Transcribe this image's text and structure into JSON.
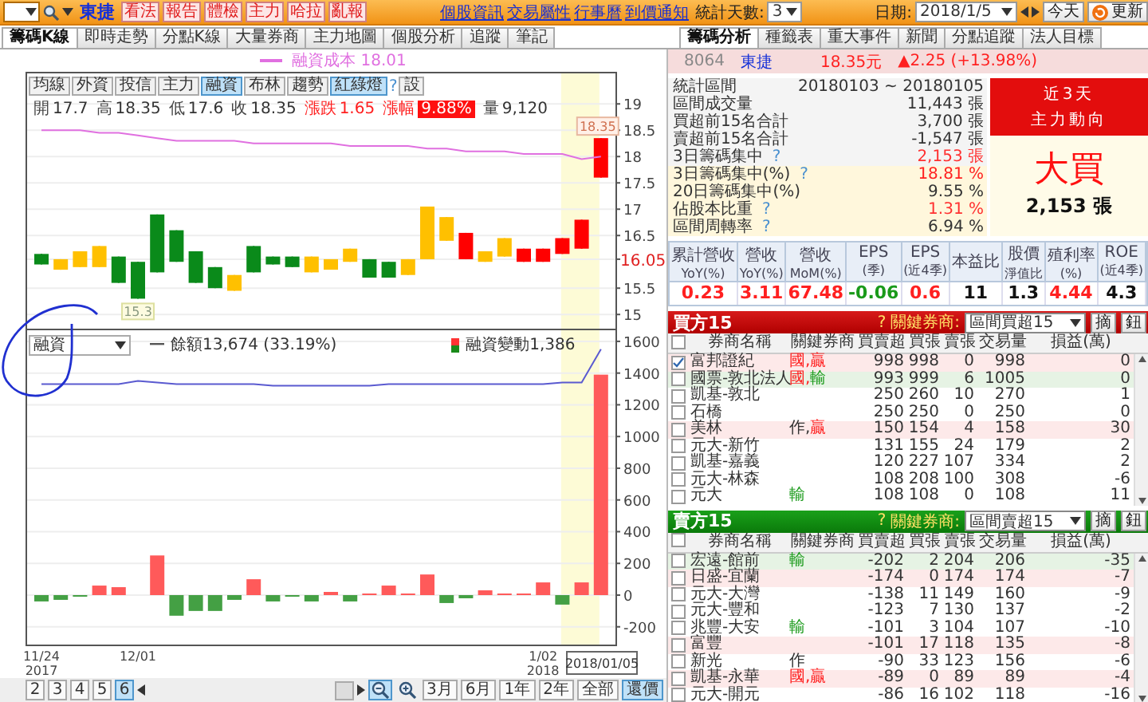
{
  "toolbar": {
    "stock_name": "東捷",
    "action_buttons": [
      "看法",
      "報告",
      "體檢",
      "主力",
      "哈拉",
      "亂報"
    ],
    "links": [
      "個股資訊",
      "交易屬性",
      "行事曆",
      "到價通知"
    ],
    "days_label": "統計天數:",
    "days_value": "3",
    "date_label": "日期:",
    "date_value": "2018/1/5",
    "today_button": "今天",
    "refresh_button": "更新"
  },
  "chart_tabs": [
    {
      "label": "籌碼K線",
      "selected": true
    },
    {
      "label": "即時走勢",
      "selected": false
    },
    {
      "label": "分點K線",
      "selected": false
    },
    {
      "label": "大量券商",
      "selected": false
    },
    {
      "label": "主力地圖",
      "selected": false
    },
    {
      "label": "個股分析",
      "selected": false
    },
    {
      "label": "追蹤",
      "selected": false
    },
    {
      "label": "筆記",
      "selected": false
    }
  ],
  "analysis_tabs": [
    {
      "label": "籌碼分析",
      "selected": true
    },
    {
      "label": "種籤表",
      "selected": false
    },
    {
      "label": "重大事件",
      "selected": false
    },
    {
      "label": "新聞",
      "selected": false
    },
    {
      "label": "分點追蹤",
      "selected": false
    },
    {
      "label": "法人目標",
      "selected": false
    }
  ],
  "chart": {
    "cost_legend": "融資成本 18.01",
    "buttons": [
      {
        "label": "均線",
        "selected": false
      },
      {
        "label": "外資",
        "selected": false
      },
      {
        "label": "投信",
        "selected": false
      },
      {
        "label": "主力",
        "selected": false
      },
      {
        "label": "融資",
        "selected": true
      },
      {
        "label": "布林",
        "selected": false
      },
      {
        "label": "趨勢",
        "selected": false
      },
      {
        "label": "紅綠燈",
        "selected": true
      }
    ],
    "help": "?",
    "settings_button": "設",
    "quote": [
      {
        "label": "開",
        "value": "17.7",
        "kind": "plain"
      },
      {
        "label": "高",
        "value": "18.35",
        "kind": "plain"
      },
      {
        "label": "低",
        "value": "17.6",
        "kind": "plain"
      },
      {
        "label": "收",
        "value": "18.35",
        "kind": "plain"
      },
      {
        "label": "漲跌",
        "value": "1.65",
        "kind": "change"
      },
      {
        "label": "漲幅",
        "value": "9.88%",
        "kind": "badge"
      },
      {
        "label": "量",
        "value": "9,120",
        "kind": "plain"
      }
    ],
    "price_chart": {
      "chart_data": {
        "type": "candlestick",
        "grid": true,
        "ylim": [
          14.7,
          19.61
        ],
        "yticks": [
          15,
          15.5,
          {
            "value": 16.05,
            "label": "16.05"
          },
          16.5,
          17,
          17.5,
          18,
          18.5,
          19
        ],
        "series": [
          {
            "color": "#0a8a1a",
            "ohlc": [
              [
                16.15,
                16.15,
                15.95,
                15.95
              ],
              null,
              null,
              null,
              [
                16.1,
                16.1,
                15.6,
                15.6
              ],
              [
                16,
                16,
                15.3,
                15.3
              ],
              [
                16.9,
                16.9,
                15.8,
                15.8
              ],
              [
                16.6,
                16.6,
                16,
                16
              ],
              [
                16.2,
                16.2,
                15.6,
                15.6
              ],
              [
                15.9,
                15.9,
                15.5,
                15.5
              ],
              null,
              [
                16.3,
                16.3,
                15.8,
                15.8
              ],
              [
                16.1,
                16.1,
                15.95,
                15.95
              ],
              [
                16.1,
                16.1,
                15.9,
                15.9
              ],
              null,
              null,
              null,
              [
                16.05,
                16.05,
                15.7,
                15.7
              ],
              [
                16,
                16,
                15.7,
                15.7
              ],
              null,
              null,
              null,
              null,
              null,
              null,
              null,
              null,
              null,
              null,
              null
            ]
          },
          {
            "color": "#ffc000",
            "ohlc": [
              null,
              [
                16.05,
                16.05,
                15.85,
                15.85
              ],
              [
                16.2,
                16.2,
                15.9,
                15.9
              ],
              [
                16.3,
                16.3,
                15.9,
                15.9
              ],
              null,
              null,
              null,
              null,
              null,
              null,
              [
                15.75,
                15.75,
                15.45,
                15.45
              ],
              null,
              null,
              null,
              [
                16.1,
                16.1,
                15.8,
                15.8
              ],
              [
                16.05,
                16.05,
                15.85,
                15.85
              ],
              [
                16.25,
                16.25,
                16,
                16
              ],
              null,
              null,
              [
                16.05,
                16.05,
                15.75,
                15.75
              ],
              [
                17.05,
                17.05,
                16.05,
                16.05
              ],
              [
                16.85,
                16.85,
                16.4,
                16.4
              ],
              null,
              [
                16.2,
                16.2,
                16,
                16
              ],
              [
                16.45,
                16.45,
                16.1,
                16.1
              ],
              null,
              null,
              null,
              null,
              null
            ]
          },
          {
            "color": "#ff0000",
            "ohlc": [
              null,
              null,
              null,
              null,
              null,
              null,
              null,
              null,
              null,
              null,
              null,
              null,
              null,
              null,
              null,
              null,
              null,
              null,
              null,
              null,
              null,
              null,
              [
                16.05,
                16.55,
                16.05,
                16.55
              ],
              null,
              null,
              [
                16,
                16.25,
                16,
                16.25
              ],
              [
                16,
                16.25,
                16,
                16.25
              ],
              [
                16.15,
                16.45,
                16.15,
                16.45
              ],
              [
                16.25,
                16.8,
                16.25,
                16.8
              ],
              [
                17.6,
                18.35,
                17.6,
                18.35
              ]
            ]
          },
          {
            "type": "line",
            "color": "#e070e0",
            "values": [
              18.5,
              18.5,
              18.5,
              18.45,
              18.45,
              18.4,
              18.35,
              18.3,
              18.3,
              18.3,
              18.3,
              18.25,
              18.25,
              18.25,
              18.25,
              18.25,
              18.2,
              18.2,
              18.2,
              18.2,
              18.15,
              18.15,
              18.1,
              18.1,
              18.1,
              18.05,
              18.05,
              18.05,
              17.95,
              18.0
            ]
          }
        ],
        "annotations": [
          "15.3",
          "18.35"
        ]
      }
    },
    "margin_chart": {
      "selector": "融資",
      "line_legend": "餘額13,674 (33.19%)",
      "bar_legend": "融資變動1,386",
      "date_tooltip": "2018/01/05",
      "chart_data": {
        "type": "bar",
        "grid": true,
        "ylim": [
          -322,
          1670
        ],
        "yticks": [
          -200,
          0,
          200,
          400,
          600,
          800,
          1000,
          1200,
          1400,
          1600
        ],
        "categories": [
          "11/24 2017",
          null,
          null,
          null,
          null,
          "12/01",
          null,
          null,
          null,
          null,
          null,
          null,
          null,
          null,
          null,
          null,
          null,
          null,
          null,
          null,
          null,
          null,
          null,
          null,
          null,
          null,
          "1/02 2018",
          null,
          null,
          null
        ],
        "series": [
          {
            "color": "#ff5a5a",
            "values": [
              null,
              null,
              null,
              60,
              50,
              null,
              250,
              null,
              null,
              null,
              null,
              100,
              null,
              null,
              null,
              20,
              null,
              10,
              60,
              10,
              130,
              null,
              null,
              30,
              10,
              10,
              80,
              null,
              80,
              1390
            ]
          },
          {
            "color": "#44a044",
            "values": [
              -40,
              -30,
              -10,
              null,
              null,
              null,
              null,
              -130,
              -100,
              -100,
              -30,
              null,
              -40,
              -10,
              -40,
              null,
              -40,
              null,
              null,
              null,
              null,
              -50,
              -20,
              null,
              null,
              null,
              null,
              -60,
              null,
              null
            ]
          },
          {
            "type": "line",
            "color": "#5a5ad0",
            "values": [
              1330,
              1330,
              1330,
              1330,
              1330,
              1350,
              1340,
              1330,
              1330,
              1330,
              1330,
              1330,
              1320,
              1320,
              1320,
              1320,
              1320,
              1320,
              1330,
              1330,
              1330,
              1330,
              1330,
              1330,
              1330,
              1330,
              1330,
              1340,
              1340,
              1550
            ]
          }
        ]
      }
    }
  },
  "pager": {
    "pages": [
      {
        "label": "2",
        "selected": false
      },
      {
        "label": "3",
        "selected": false
      },
      {
        "label": "4",
        "selected": false
      },
      {
        "label": "5",
        "selected": false
      },
      {
        "label": "6",
        "selected": true
      }
    ],
    "zoom_tools": [
      {
        "kind": "zoom-out",
        "selected": true
      },
      {
        "kind": "zoom-in",
        "selected": false
      }
    ],
    "ranges": [
      {
        "label": "3月",
        "selected": false
      },
      {
        "label": "6月",
        "selected": false
      },
      {
        "label": "1年",
        "selected": false
      },
      {
        "label": "2年",
        "selected": false
      },
      {
        "label": "全部",
        "selected": false
      },
      {
        "label": "還價",
        "selected": true
      }
    ]
  },
  "stock_header": {
    "code": "8064",
    "name": "東捷",
    "price": "18.35元",
    "change": "▲2.25 (+13.98%)"
  },
  "stats": [
    {
      "label": "統計區間",
      "value": "20180103 ~ 20180105",
      "color": "#333333"
    },
    {
      "label": "區間成交量",
      "value": "11,443 張",
      "color": "#333333"
    },
    {
      "label": "買超前15名合計",
      "value": "3,700 張",
      "color": "#333333"
    },
    {
      "label": "賣超前15名合計",
      "value": "-1,547 張",
      "color": "#333333"
    },
    {
      "label": "3日籌碼集中",
      "help": "?",
      "value": "2,153 張",
      "color": "#ff3030"
    }
  ],
  "concentration": [
    {
      "label": "3日籌碼集中(%)",
      "help": "?",
      "value": "18.81 %",
      "color": "#ff2020"
    },
    {
      "label": "20日籌碼集中(%)",
      "value": "9.55 %",
      "color": "#333333"
    },
    {
      "label": "佔股本比重",
      "help": "?",
      "value": "1.31 %",
      "color": "#ff3030"
    },
    {
      "label": "區間周轉率",
      "help": "?",
      "value": "6.94 %",
      "color": "#333333"
    }
  ],
  "trend_box": {
    "header": [
      "近3天",
      "主力動向"
    ],
    "verdict": "大買",
    "amount": "2,153 張"
  },
  "metrics": [
    {
      "label": "累計營收",
      "sublabel": "YoY(%)",
      "value": "0.23",
      "color": "#ff2020"
    },
    {
      "label": "營收",
      "sublabel": "YoY(%)",
      "value": "3.11",
      "color": "#ff2020"
    },
    {
      "label": "營收",
      "sublabel": "MoM(%)",
      "value": "67.48",
      "color": "#ff2020"
    },
    {
      "label": "EPS",
      "sublabel": "(季)",
      "value": "-0.06",
      "color": "#1a9a1a"
    },
    {
      "label": "EPS",
      "sublabel": "(近4季)",
      "value": "0.6",
      "color": "#ff2020"
    },
    {
      "label": "本益比",
      "value": "11",
      "color": "#111111"
    },
    {
      "label": "股價",
      "sublabel": "淨值比",
      "value": "1.3",
      "color": "#111111"
    },
    {
      "label": "殖利率",
      "sublabel": "(%)",
      "value": "4.44",
      "color": "#ff2020"
    },
    {
      "label": "ROE",
      "sublabel": "(近4季)",
      "value": "4.3",
      "color": "#111111"
    }
  ],
  "tables": [
    {
      "title": "買方15",
      "kind": "buy",
      "help": "?",
      "key_label": "關鍵券商:",
      "filter": "區間買超15",
      "buttons": [
        "摘",
        "鈕"
      ],
      "header_checked": false,
      "columns": [
        "券商名稱",
        "關鍵券商",
        "買賣超",
        "買張",
        "賣張",
        "交易量",
        "損益(萬)"
      ],
      "rows": [
        {
          "checked": true,
          "name": "富邦證紀",
          "key": [
            {
              "text": "國,贏",
              "color": "#ff2020"
            }
          ],
          "net": "998",
          "buy": "998",
          "sell": "0",
          "volume": "998",
          "pnl": "0",
          "color": "#fde9e9"
        },
        {
          "checked": false,
          "name": "國票-敦北法人",
          "key": [
            {
              "text": "國,",
              "color": "#ff2020"
            },
            {
              "text": "輸",
              "color": "#1a9a1a"
            }
          ],
          "net": "993",
          "buy": "999",
          "sell": "6",
          "volume": "1005",
          "pnl": "0",
          "color": "#e6f3e4"
        },
        {
          "checked": false,
          "name": "凱基-敦北",
          "net": "250",
          "buy": "260",
          "sell": "10",
          "volume": "270",
          "pnl": "1"
        },
        {
          "checked": false,
          "name": "石橋",
          "net": "250",
          "buy": "250",
          "sell": "0",
          "volume": "250",
          "pnl": "0"
        },
        {
          "checked": false,
          "name": "美林",
          "key": [
            {
              "text": "作,",
              "color": "#333333"
            },
            {
              "text": "贏",
              "color": "#ff2020"
            }
          ],
          "net": "150",
          "buy": "154",
          "sell": "4",
          "volume": "158",
          "pnl": "30",
          "color": "#fde9e9"
        },
        {
          "checked": false,
          "name": "元大-新竹",
          "net": "131",
          "buy": "155",
          "sell": "24",
          "volume": "179",
          "pnl": "2"
        },
        {
          "checked": false,
          "name": "凱基-嘉義",
          "net": "120",
          "buy": "227",
          "sell": "107",
          "volume": "334",
          "pnl": "2"
        },
        {
          "checked": false,
          "name": "元大-林森",
          "net": "108",
          "buy": "208",
          "sell": "100",
          "volume": "308",
          "pnl": "-6"
        },
        {
          "checked": false,
          "name": "元大",
          "key": [
            {
              "text": "輸",
              "color": "#1a9a1a"
            }
          ],
          "net": "108",
          "buy": "108",
          "sell": "0",
          "volume": "108",
          "pnl": "11"
        }
      ]
    },
    {
      "title": "賣方15",
      "kind": "sell",
      "help": "?",
      "key_label": "關鍵券商:",
      "filter": "區間賣超15",
      "buttons": [
        "摘",
        "鈕"
      ],
      "header_checked": false,
      "columns": [
        "券商名稱",
        "關鍵券商",
        "買賣超",
        "買張",
        "賣張",
        "交易量",
        "損益(萬)"
      ],
      "rows": [
        {
          "checked": false,
          "name": "宏遠-館前",
          "key": [
            {
              "text": "輸",
              "color": "#1a9a1a"
            }
          ],
          "net": "-202",
          "buy": "2",
          "sell": "204",
          "volume": "206",
          "pnl": "-35",
          "color": "#e6f3e4"
        },
        {
          "checked": false,
          "name": "日盛-宜蘭",
          "net": "-174",
          "buy": "0",
          "sell": "174",
          "volume": "174",
          "pnl": "-7",
          "color": "#fde9e9"
        },
        {
          "checked": false,
          "name": "元大-大灣",
          "net": "-138",
          "buy": "11",
          "sell": "149",
          "volume": "160",
          "pnl": "-9"
        },
        {
          "checked": false,
          "name": "元大-豐和",
          "net": "-123",
          "buy": "7",
          "sell": "130",
          "volume": "137",
          "pnl": "-2"
        },
        {
          "checked": false,
          "name": "兆豐-大安",
          "key": [
            {
              "text": "輸",
              "color": "#1a9a1a"
            }
          ],
          "net": "-101",
          "buy": "3",
          "sell": "104",
          "volume": "107",
          "pnl": "-10"
        },
        {
          "checked": false,
          "name": "富豐",
          "net": "-101",
          "buy": "17",
          "sell": "118",
          "volume": "135",
          "pnl": "-8",
          "color": "#fde9e9"
        },
        {
          "checked": false,
          "name": "新光",
          "key": [
            {
              "text": "作",
              "color": "#333333"
            }
          ],
          "net": "-90",
          "buy": "33",
          "sell": "123",
          "volume": "156",
          "pnl": "-6"
        },
        {
          "checked": false,
          "name": "凱基-永華",
          "key": [
            {
              "text": "國,贏",
              "color": "#ff2020"
            }
          ],
          "net": "-89",
          "buy": "0",
          "sell": "89",
          "volume": "89",
          "pnl": "-4",
          "color": "#fde9e9"
        },
        {
          "checked": false,
          "name": "元大-開元",
          "net": "-86",
          "buy": "16",
          "sell": "102",
          "volume": "118",
          "pnl": "-16"
        }
      ]
    }
  ]
}
